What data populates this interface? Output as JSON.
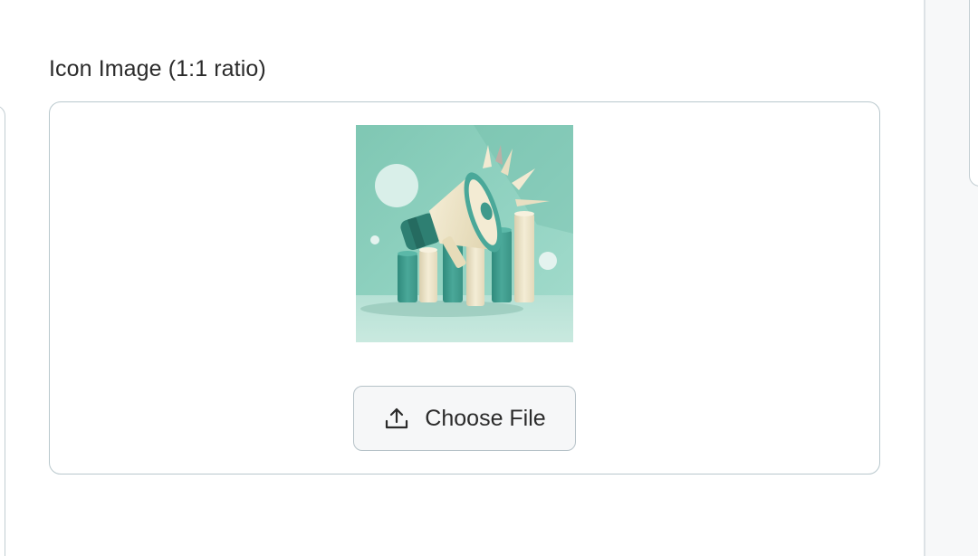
{
  "field": {
    "label": "Icon Image (1:1 ratio)"
  },
  "uploader": {
    "preview_icon": "megaphone-with-bar-chart-illustration",
    "choose_button_label": "Choose File",
    "choose_button_icon": "upload-icon"
  },
  "colors": {
    "preview_background": "#8fcfbe",
    "teal_accent": "#3f9a8c",
    "cream": "#efe6c9",
    "border": "#b9c8cd",
    "text": "#2b2b2b"
  }
}
